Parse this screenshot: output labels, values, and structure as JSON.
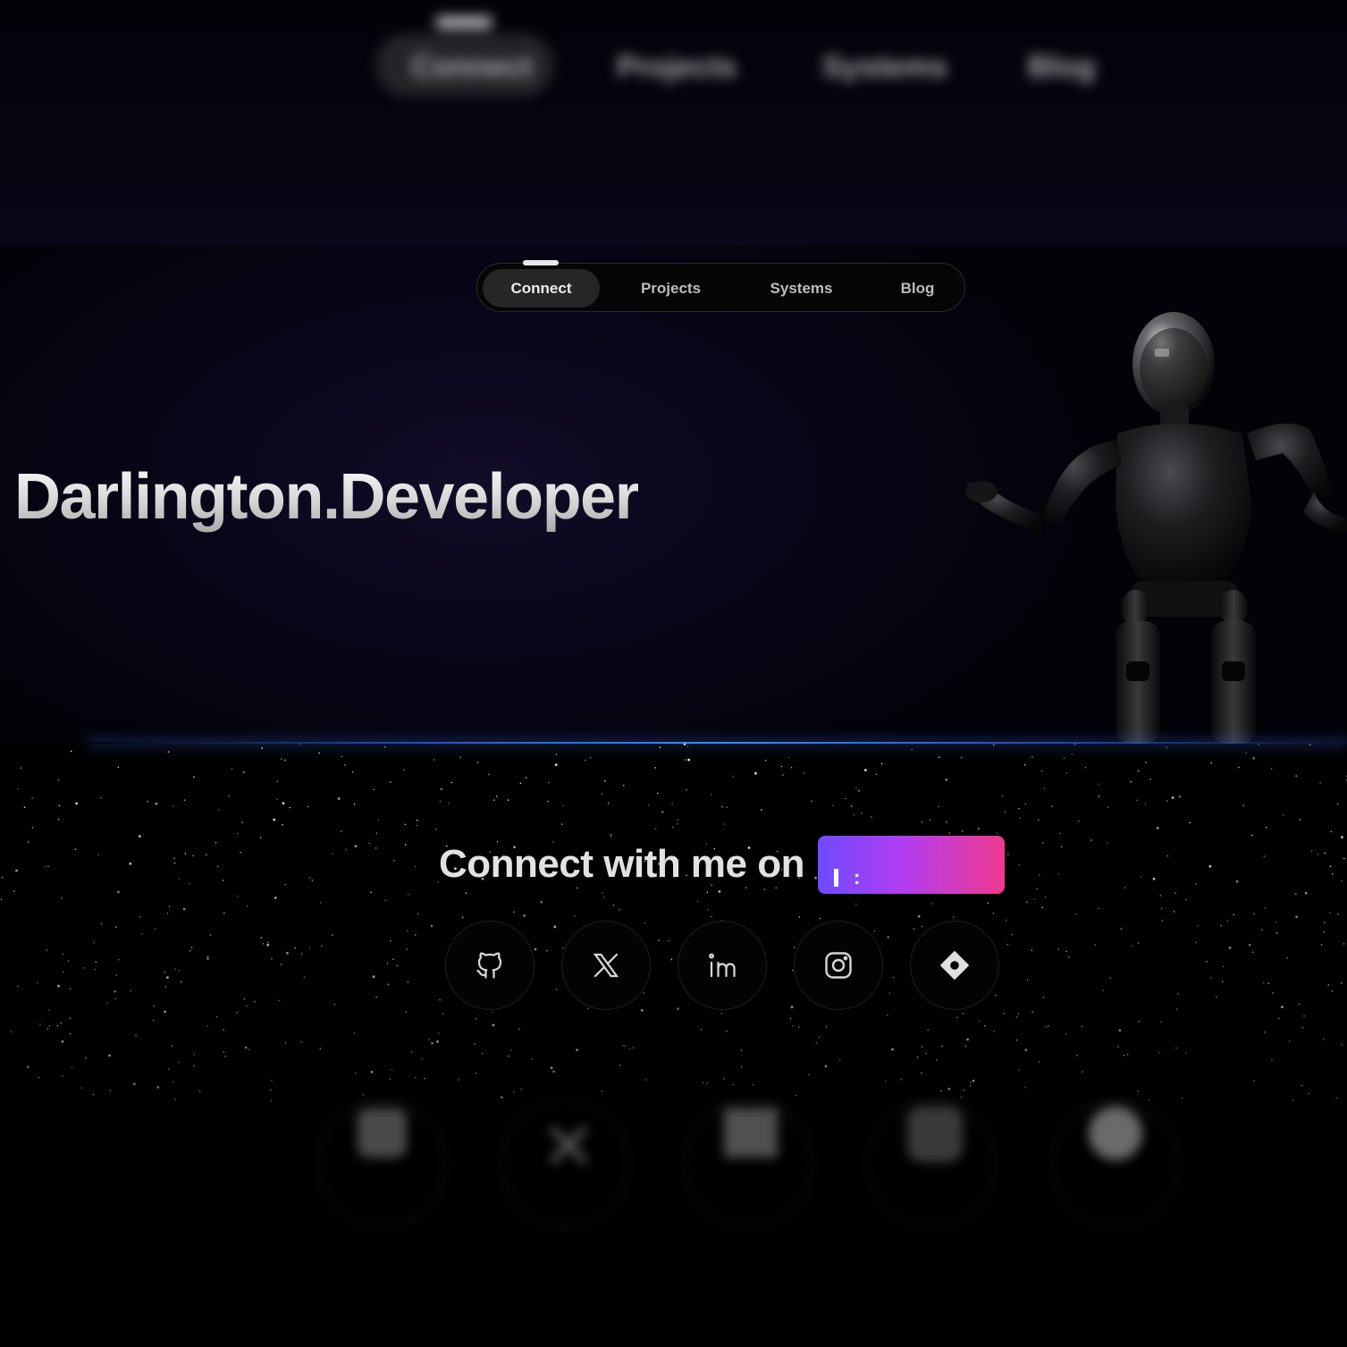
{
  "nav": {
    "items": [
      {
        "label": "Connect",
        "active": true
      },
      {
        "label": "Projects",
        "active": false
      },
      {
        "label": "Systems",
        "active": false
      },
      {
        "label": "Blog",
        "active": false
      }
    ]
  },
  "hero": {
    "title": "Darlington.Developer",
    "figure": "robot-figure"
  },
  "connect": {
    "heading": "Connect with me on",
    "typing_text": ":",
    "gradient_colors": [
      "#6e4bff",
      "#b13df2",
      "#f0398f"
    ]
  },
  "socials": [
    {
      "name": "github",
      "icon": "github-icon"
    },
    {
      "name": "x",
      "icon": "x-icon"
    },
    {
      "name": "linkedin",
      "icon": "linkedin-icon"
    },
    {
      "name": "instagram",
      "icon": "instagram-icon"
    },
    {
      "name": "directions",
      "icon": "diamond-icon"
    }
  ],
  "colors": {
    "background": "#000000",
    "accent_line": "#3b8cff"
  }
}
